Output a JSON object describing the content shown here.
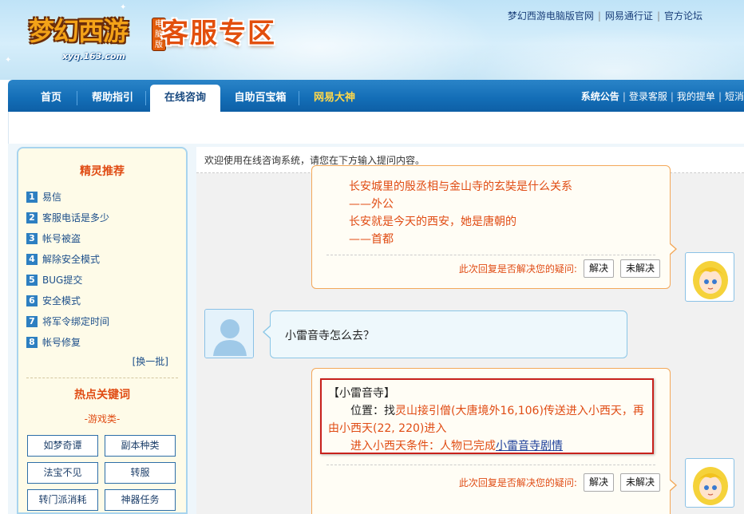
{
  "header": {
    "logo_text": "梦幻西游",
    "logo_badge": "电脑版",
    "logo_url": "xyq.163.com",
    "zone_title": "客服专区",
    "top_links": [
      "梦幻西游电脑版官网",
      "网易通行证",
      "官方论坛"
    ]
  },
  "nav": {
    "tabs": [
      {
        "label": "首页"
      },
      {
        "label": "帮助指引"
      },
      {
        "label": "在线咨询"
      },
      {
        "label": "自助百宝箱"
      },
      {
        "label": "网易大神"
      }
    ],
    "right_links": [
      "系统公告",
      "登录客服",
      "我的提单",
      "短消"
    ]
  },
  "sidebar": {
    "title": "精灵推荐",
    "items": [
      {
        "num": "1",
        "label": "易信"
      },
      {
        "num": "2",
        "label": "客服电话是多少"
      },
      {
        "num": "3",
        "label": "帐号被盗"
      },
      {
        "num": "4",
        "label": "解除安全模式"
      },
      {
        "num": "5",
        "label": "BUG提交"
      },
      {
        "num": "6",
        "label": "安全模式"
      },
      {
        "num": "7",
        "label": "将军令绑定时间"
      },
      {
        "num": "8",
        "label": "帐号修复"
      }
    ],
    "more": "[换一批]",
    "hot_title": "热点关键词",
    "hot_sub": "-游戏类-",
    "keywords": [
      "如梦奇谭",
      "副本种类",
      "法宝不见",
      "转服",
      "转门派消耗",
      "神器任务"
    ]
  },
  "chat": {
    "welcome": "欢迎使用在线咨询系统，请您在下方输入提问内容。",
    "prev_answer_lines": [
      "长安城里的殷丞相与金山寺的玄奘是什么关系",
      "——外公",
      "长安就是今天的西安，她是唐朝的",
      "——首都"
    ],
    "resolve_prompt": "此次回复是否解决您的疑问:",
    "resolved_btn": "解决",
    "unresolved_btn": "未解决",
    "user_question": "小雷音寺怎么去？",
    "answer": {
      "title": "【小雷音寺】",
      "pos_label": "位置：找",
      "pos_text": "灵山接引僧(大唐境外16,106)传送进入小西天，再由小西天(22, 220)进入",
      "cond_label": "进入小西天条件：人物已完成",
      "cond_link": "小雷音寺剧情"
    }
  }
}
